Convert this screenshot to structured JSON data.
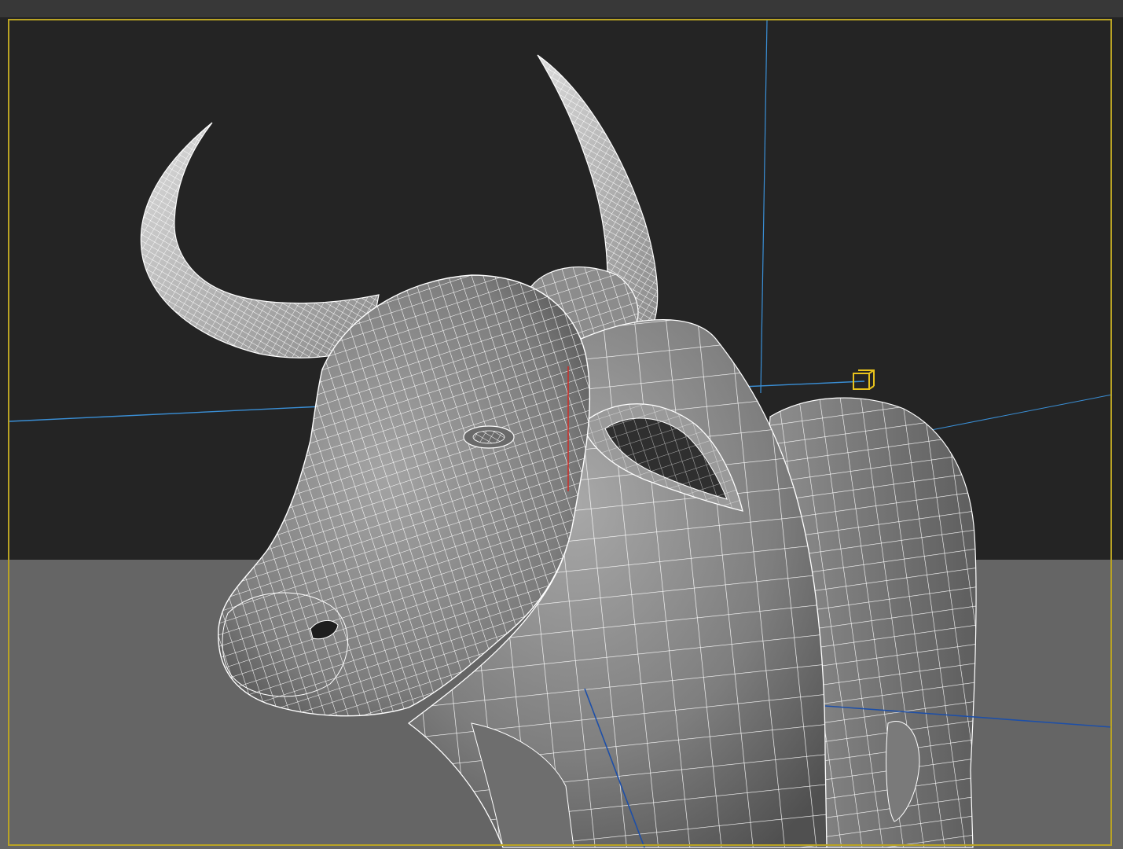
{
  "app": {
    "viewport_label": ""
  },
  "colors": {
    "background_upper": "#242424",
    "background_floor": "#656565",
    "wire": "#ffffff",
    "grid_line": "#3a8fd6",
    "grid_line_dark": "#1d4fa8",
    "active_frame": "#b9a324",
    "gizmo": "#e8c21c",
    "pivot_marker": "#c8322c"
  },
  "scene": {
    "object_name": "",
    "display_mode": "wireframe-over-shaded",
    "icons": [
      "camera-target-icon"
    ]
  }
}
